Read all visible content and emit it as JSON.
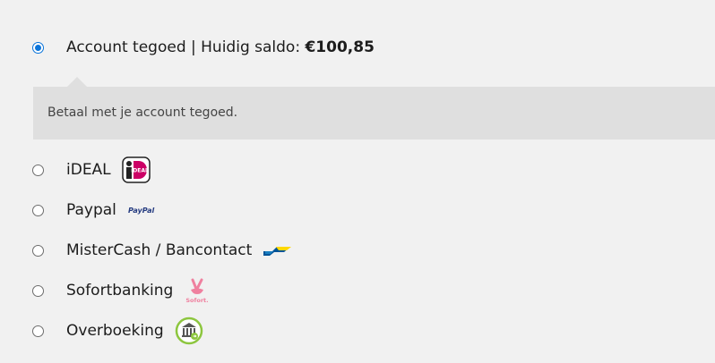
{
  "payment_methods": [
    {
      "id": "account",
      "label": "Account tegoed | Huidig saldo: ",
      "amount": "€100,85",
      "selected": true,
      "description": "Betaal met je account tegoed."
    },
    {
      "id": "ideal",
      "label": "iDEAL",
      "selected": false,
      "icon": "ideal-logo-icon",
      "icon_text": "iDEAL"
    },
    {
      "id": "paypal",
      "label": "Paypal",
      "selected": false,
      "icon": "paypal-logo-icon",
      "icon_text": "PayPal"
    },
    {
      "id": "bancontact",
      "label": "MisterCash / Bancontact",
      "selected": false,
      "icon": "bancontact-logo-icon"
    },
    {
      "id": "sofort",
      "label": "Sofortbanking",
      "selected": false,
      "icon": "sofort-logo-icon",
      "icon_text": "Sofort."
    },
    {
      "id": "overboeking",
      "label": "Overboeking",
      "selected": false,
      "icon": "bank-transfer-icon"
    }
  ],
  "colors": {
    "radio_accent": "#0a74da",
    "ideal_pink": "#cc0066",
    "paypal_blue": "#253b80",
    "paypal_light_blue": "#179bd7",
    "bancontact_blue": "#005498",
    "bancontact_yellow": "#ffd800",
    "sofort_pink": "#ef809f",
    "bank_green": "#8dc63f",
    "description_background": "#dfdfdf",
    "page_background": "#f1f1f1"
  }
}
